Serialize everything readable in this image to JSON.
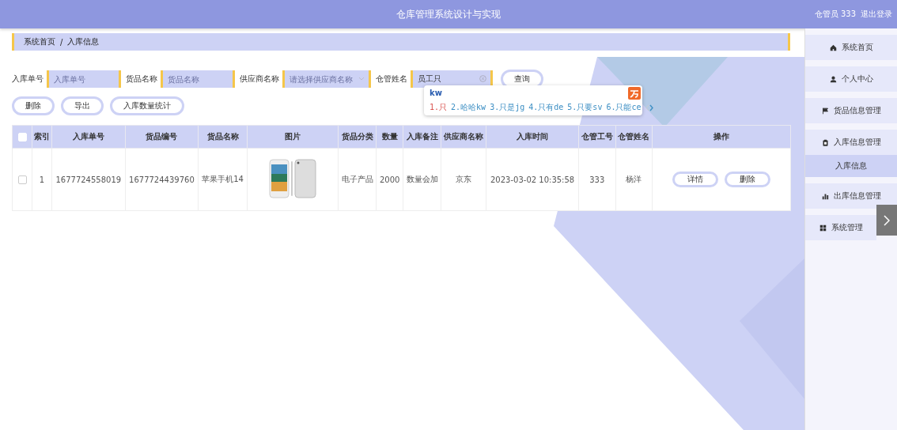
{
  "header": {
    "title": "仓库管理系统设计与实现",
    "user": "仓管员 333",
    "logout": "退出登录"
  },
  "breadcrumb": [
    "系统首页",
    "/",
    "入库信息"
  ],
  "search": [
    {
      "label": "入库单号",
      "kind": "input",
      "placeholder": "入库单号"
    },
    {
      "label": "货品名称",
      "kind": "input",
      "placeholder": "货品名称"
    },
    {
      "label": "供应商名称",
      "kind": "select",
      "placeholder": "请选择供应商名称"
    },
    {
      "label": "仓管姓名",
      "kind": "input",
      "value": "员工只"
    }
  ],
  "query_button": "查询",
  "actions": [
    "删除",
    "导出",
    "入库数量统计"
  ],
  "ime": {
    "input": "kw",
    "candidates": [
      {
        "text": "1.只",
        "selected": true
      },
      {
        "text": "2.哈哈kw",
        "selected": false
      },
      {
        "text": "3.只是jg",
        "selected": false
      },
      {
        "text": "4.只有de",
        "selected": false
      },
      {
        "text": "5.只要sv",
        "selected": false
      },
      {
        "text": "6.只能ce",
        "selected": false
      }
    ]
  },
  "table": {
    "select_all_checked": false,
    "columns": [
      "索引",
      "入库单号",
      "货品编号",
      "货品名称",
      "图片",
      "货品分类",
      "数量",
      "入库备注",
      "供应商名称",
      "入库时间",
      "仓管工号",
      "仓管姓名",
      "操作"
    ],
    "rows": [
      {
        "checked": false,
        "cells": [
          "1",
          "1677724558019",
          "1677724439760",
          "苹果手机14",
          {
            "kind": "picture"
          },
          "电子产品",
          "2000",
          "数量会加",
          "京东",
          "2023-03-02 10:35:58",
          "333",
          "杨洋"
        ],
        "buttons": [
          "详情",
          "删除"
        ]
      }
    ]
  },
  "sidebar": [
    {
      "label": "系统首页",
      "kind": "home",
      "selected": false
    },
    {
      "label": "个人中心",
      "kind": "person",
      "selected": false
    },
    {
      "label": "货品信息管理",
      "kind": "flag",
      "selected": false
    },
    {
      "label": "入库信息管理",
      "kind": "clipboard",
      "selected": false,
      "children": [
        {
          "label": "入库信息",
          "selected": true
        }
      ]
    },
    {
      "label": "出库信息管理",
      "kind": "chart",
      "selected": false
    },
    {
      "label": "系统管理",
      "kind": "grid",
      "selected": false
    }
  ]
}
